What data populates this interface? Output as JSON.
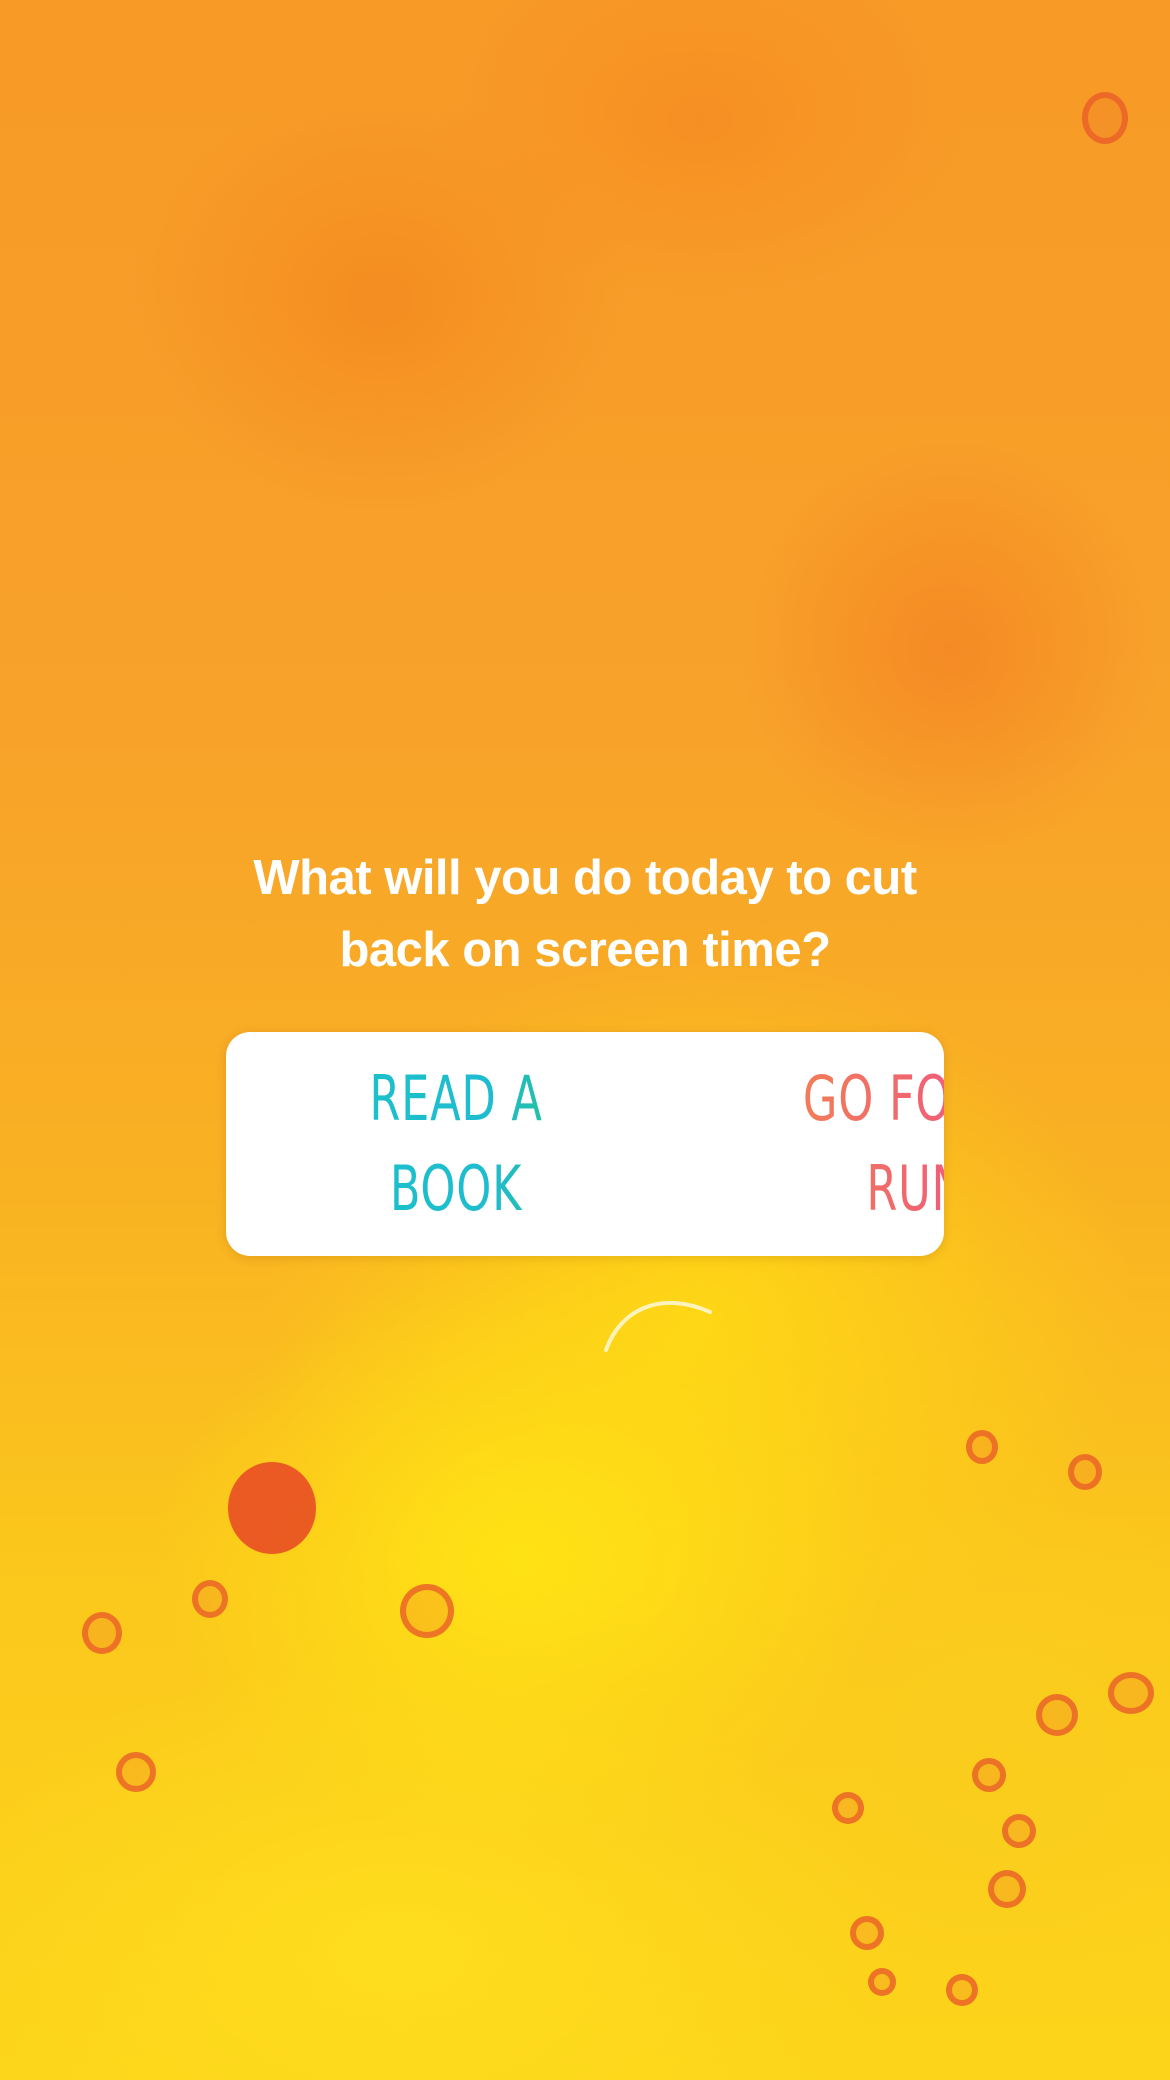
{
  "story": {
    "question_lines": [
      "What will you do today to cut",
      "back on screen time?"
    ]
  },
  "poll": {
    "options": [
      {
        "lines": [
          "READ A",
          "BOOK"
        ]
      },
      {
        "lines": [
          "GO FOR A",
          "RUN"
        ]
      }
    ]
  },
  "colors": {
    "background_top": "#f79a26",
    "background_bottom": "#fcd51a",
    "question_text": "#ffffff",
    "poll_card": "#ffffff",
    "left_option_gradient": [
      "#17c3c5",
      "#27c46a"
    ],
    "right_option_gradient": [
      "#f2884c",
      "#ef3f92"
    ]
  }
}
